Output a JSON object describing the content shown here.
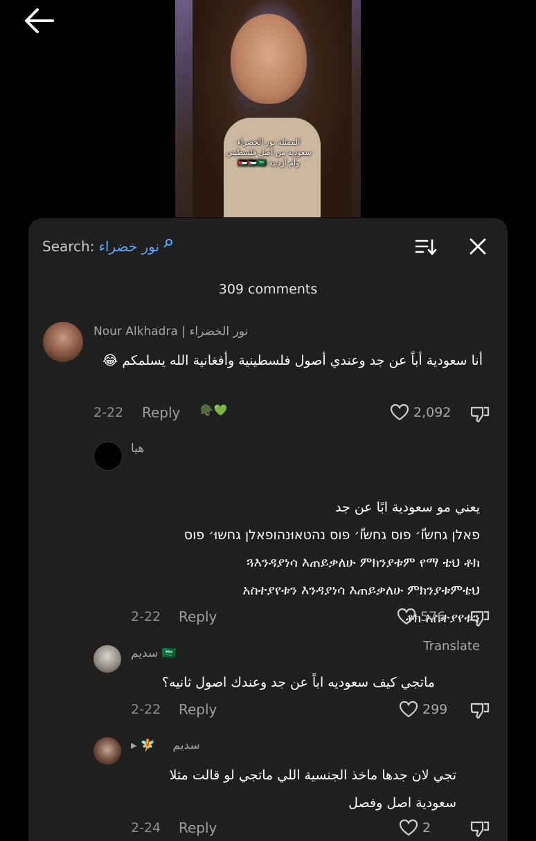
{
  "video": {
    "caption_lines": [
      "الممثلة نور الخضراء",
      "سعودية من أصل فلسطيني",
      "وأم أردنية 🇯🇴🇵🇸🇸🇦"
    ]
  },
  "search": {
    "label": "Search:",
    "query": "نور خضراء"
  },
  "comments_count": "309 comments",
  "comments": [
    {
      "name": "Nour Alkhadra | نور الخضراء",
      "text": "أنا سعودية أباً عن جد وعندي أصول فلسطينية وأفغانية الله يسلمكم 😂",
      "date": "2-22",
      "reply": "Reply",
      "likes": "2,092",
      "badge": "🪖💚"
    },
    {
      "name": "هيا",
      "text": "يعني مو سعودية ابًا عن جد\nפאלן גחשוّ׳ פוס גחשוّ׳ פוס נהטאוּנהופאלן גחשוּ׳ פוס\nጓእንዳያነሳ እጠይቃለሁ ምክንያቱም የማ ቴህ ቶክ\nአስተያየቱን እንዳያነሳ እጠይቃለሁ ምክንያቱምቴህ\nቶክ አስተያየቱን",
      "translate": "Translate",
      "date": "2-22",
      "reply": "Reply",
      "likes": "576"
    },
    {
      "name": "سديم",
      "flag": "🇸🇦",
      "text": "ماتجي كيف سعوديه اباً عن جد وعندك اصول ثانيه؟",
      "date": "2-22",
      "reply": "Reply",
      "likes": "299"
    },
    {
      "name": "سديم",
      "prefix": "🧚 ▸",
      "text": "تجي لان جدها ماخذ الجنسية اللي ماتجي لو قالت مثلا\nسعودية اصل وفصل",
      "date": "2-24",
      "reply": "Reply",
      "likes": "2"
    }
  ]
}
